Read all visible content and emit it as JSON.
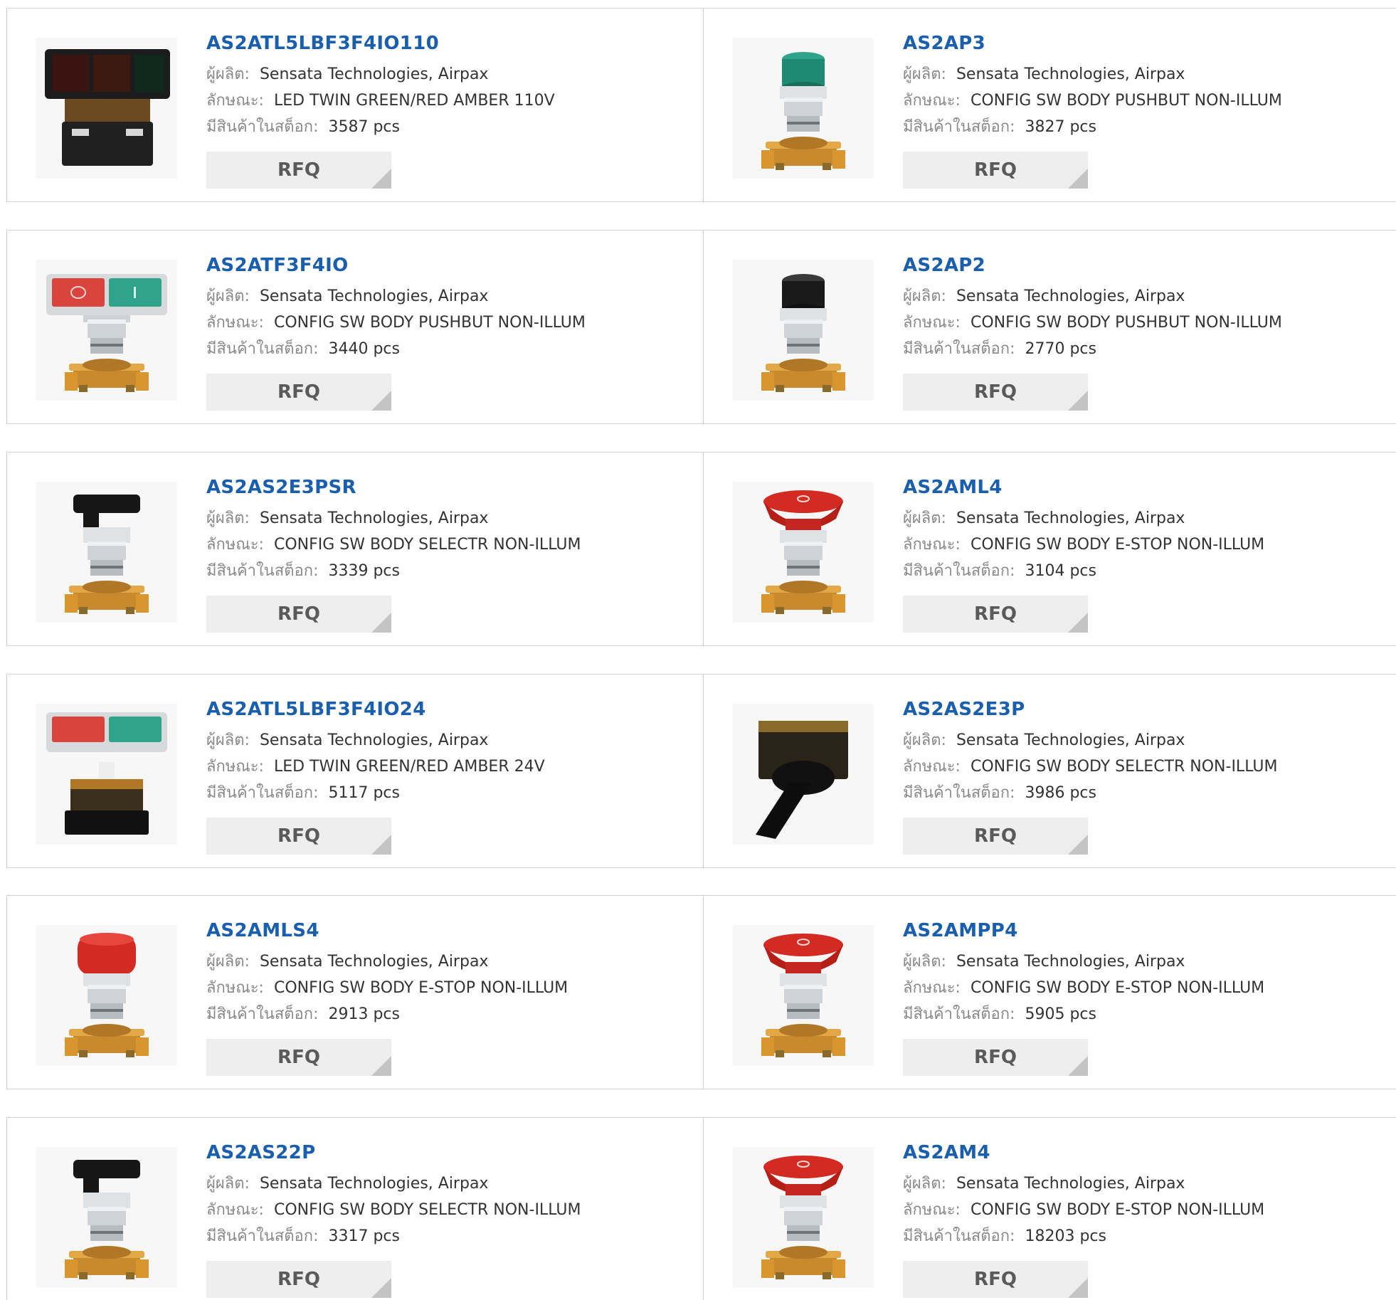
{
  "labels": {
    "manufacturer": "ผู้ผลิต:",
    "description": "ลักษณะ:",
    "stock": "มีสินค้าในสต็อก:"
  },
  "rfq_label": "RFQ",
  "colors": {
    "part_link": "#1a5fae",
    "border": "#d2d2d2",
    "rfq_bg": "#eeeeee"
  },
  "products": [
    {
      "part": "AS2ATL5LBF3F4IO110",
      "manufacturer": "Sensata Technologies, Airpax",
      "description": "LED TWIN GREEN/RED AMBER 110V",
      "stock": "3587 pcs",
      "image": "twin-pushbutton-block-icon"
    },
    {
      "part": "AS2AP3",
      "manufacturer": "Sensata Technologies, Airpax",
      "description": "CONFIG SW BODY PUSHBUT NON-ILLUM",
      "stock": "3827 pcs",
      "image": "green-pushbutton-icon"
    },
    {
      "part": "AS2ATF3F4IO",
      "manufacturer": "Sensata Technologies, Airpax",
      "description": "CONFIG SW BODY PUSHBUT NON-ILLUM",
      "stock": "3440 pcs",
      "image": "twin-pushbutton-icon"
    },
    {
      "part": "AS2AP2",
      "manufacturer": "Sensata Technologies, Airpax",
      "description": "CONFIG SW BODY PUSHBUT NON-ILLUM",
      "stock": "2770 pcs",
      "image": "black-pushbutton-icon"
    },
    {
      "part": "AS2AS2E3PSR",
      "manufacturer": "Sensata Technologies, Airpax",
      "description": "CONFIG SW BODY SELECTR NON-ILLUM",
      "stock": "3339 pcs",
      "image": "selector-switch-icon"
    },
    {
      "part": "AS2AML4",
      "manufacturer": "Sensata Technologies, Airpax",
      "description": "CONFIG SW BODY E-STOP NON-ILLUM",
      "stock": "3104 pcs",
      "image": "estop-mushroom-icon"
    },
    {
      "part": "AS2ATL5LBF3F4IO24",
      "manufacturer": "Sensata Technologies, Airpax",
      "description": "LED TWIN GREEN/RED AMBER 24V",
      "stock": "5117 pcs",
      "image": "twin-pushbutton-led-icon"
    },
    {
      "part": "AS2AS2E3P",
      "manufacturer": "Sensata Technologies, Airpax",
      "description": "CONFIG SW BODY SELECTR NON-ILLUM",
      "stock": "3986 pcs",
      "image": "selector-lever-icon"
    },
    {
      "part": "AS2AMLS4",
      "manufacturer": "Sensata Technologies, Airpax",
      "description": "CONFIG SW BODY E-STOP NON-ILLUM",
      "stock": "2913 pcs",
      "image": "estop-flat-icon"
    },
    {
      "part": "AS2AMPP4",
      "manufacturer": "Sensata Technologies, Airpax",
      "description": "CONFIG SW BODY E-STOP NON-ILLUM",
      "stock": "5905 pcs",
      "image": "estop-mushroom-icon"
    },
    {
      "part": "AS2AS22P",
      "manufacturer": "Sensata Technologies, Airpax",
      "description": "CONFIG SW BODY SELECTR NON-ILLUM",
      "stock": "3317 pcs",
      "image": "selector-switch-icon"
    },
    {
      "part": "AS2AM4",
      "manufacturer": "Sensata Technologies, Airpax",
      "description": "CONFIG SW BODY E-STOP NON-ILLUM",
      "stock": "18203 pcs",
      "image": "estop-mushroom-icon"
    }
  ]
}
